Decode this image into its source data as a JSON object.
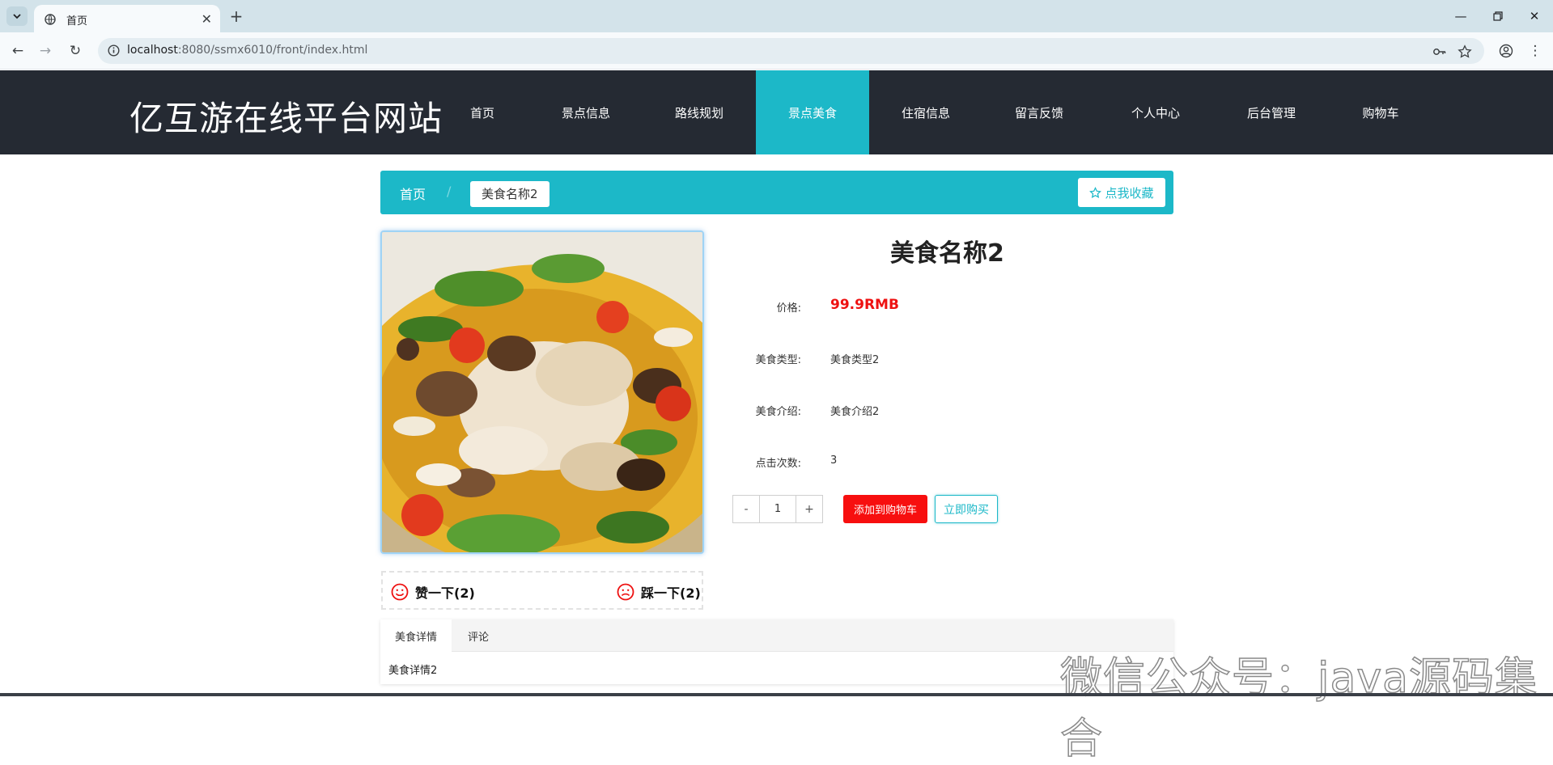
{
  "browser": {
    "tab_title": "首页",
    "url_host": "localhost",
    "url_rest": ":8080/ssmx6010/front/index.html"
  },
  "site": {
    "brand": "亿互游在线平台网站",
    "nav": [
      "首页",
      "景点信息",
      "路线规划",
      "景点美食",
      "住宿信息",
      "留言反馈",
      "个人中心",
      "后台管理",
      "购物车"
    ],
    "active_nav": "景点美食"
  },
  "breadcrumb": {
    "home": "首页",
    "separator": "/",
    "current": "美食名称2",
    "favorite_label": "点我收藏"
  },
  "product": {
    "title": "美食名称2",
    "price_label": "价格:",
    "price_value": "99.9RMB",
    "type_label": "美食类型:",
    "type_value": "美食类型2",
    "intro_label": "美食介绍:",
    "intro_value": "美食介绍2",
    "clicks_label": "点击次数:",
    "clicks_value": "3",
    "quantity": "1",
    "minus": "-",
    "plus": "+",
    "add_cart_label": "添加到购物车",
    "buy_now_label": "立即购买"
  },
  "votes": {
    "like_label": "赞一下(2)",
    "dislike_label": "踩一下(2)"
  },
  "detail_tabs": {
    "tabs": [
      "美食详情",
      "评论"
    ],
    "active": "美食详情",
    "content": "美食详情2"
  },
  "watermark": "微信公众号：java源码集合",
  "colors": {
    "accent": "#1cb8c8",
    "header_bg": "#252a33",
    "price": "#ee1111",
    "cart_button": "#f70f0f"
  }
}
